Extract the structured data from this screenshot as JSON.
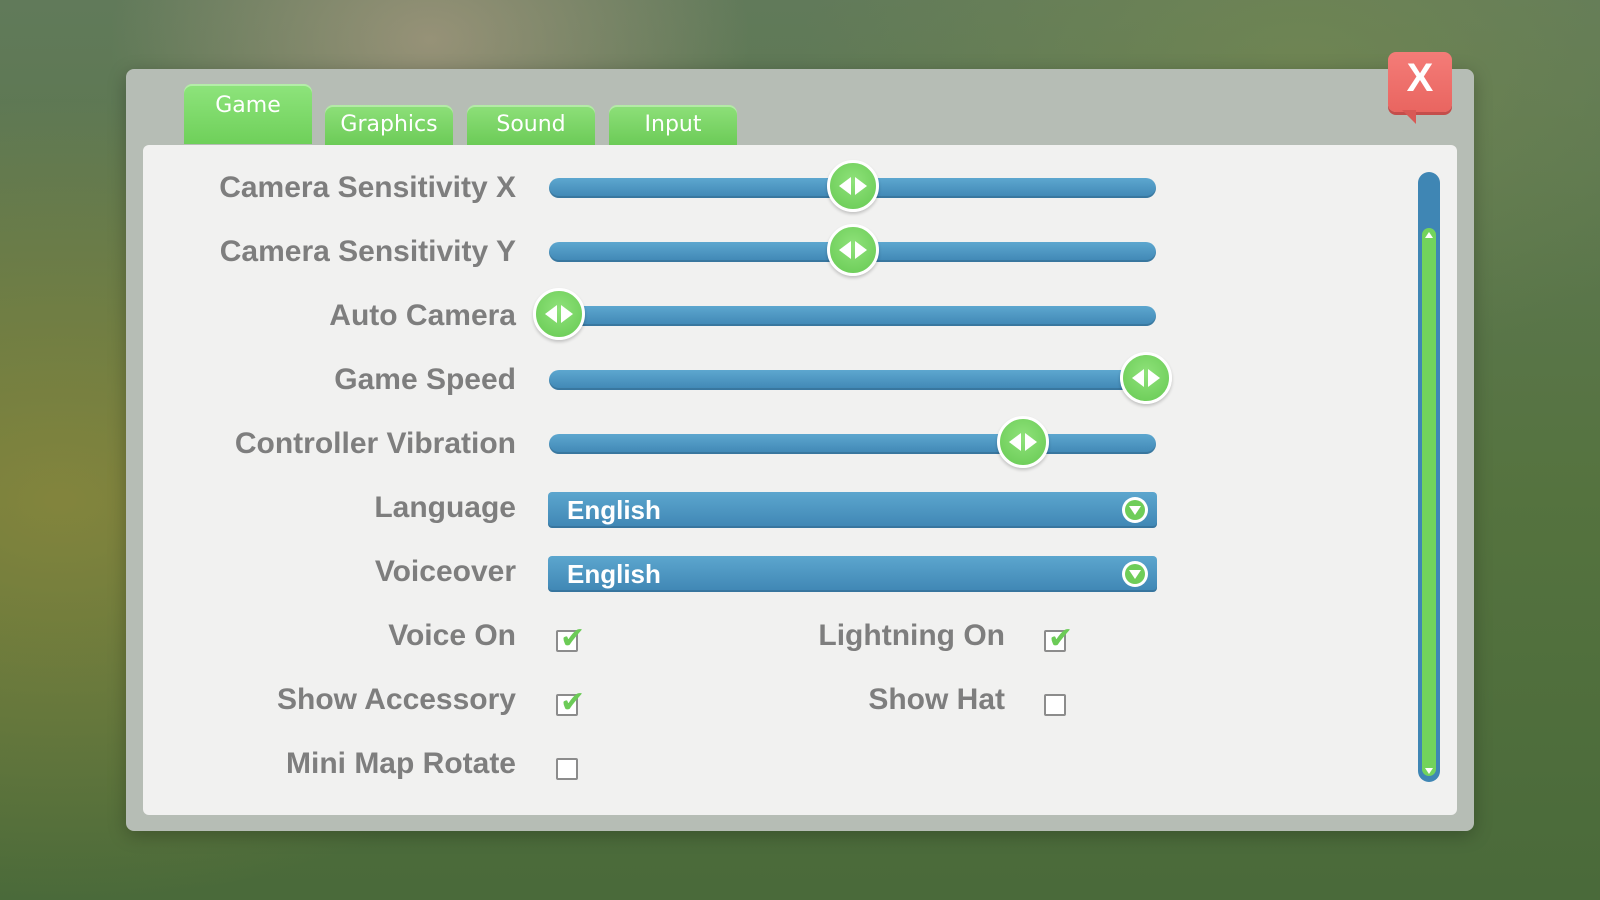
{
  "tabs": [
    {
      "label": "Game",
      "active": true
    },
    {
      "label": "Graphics",
      "active": false
    },
    {
      "label": "Sound",
      "active": false
    },
    {
      "label": "Input",
      "active": false
    }
  ],
  "close": {
    "label": "X"
  },
  "sliders": [
    {
      "label": "Camera Sensitivity X",
      "value": 0.5
    },
    {
      "label": "Camera Sensitivity Y",
      "value": 0.5
    },
    {
      "label": "Auto Camera",
      "value": 0.0
    },
    {
      "label": "Game Speed",
      "value": 1.0
    },
    {
      "label": "Controller Vibration",
      "value": 0.79
    }
  ],
  "dropdowns": [
    {
      "label": "Language",
      "value": "English"
    },
    {
      "label": "Voiceover",
      "value": "English"
    }
  ],
  "checkboxes": {
    "voice_on": {
      "label": "Voice On",
      "checked": true
    },
    "lightning_on": {
      "label": "Lightning On",
      "checked": true
    },
    "show_accessory": {
      "label": "Show Accessory",
      "checked": true
    },
    "show_hat": {
      "label": "Show Hat",
      "checked": false
    },
    "mini_map_rotate": {
      "label": "Mini Map Rotate",
      "checked": false
    }
  },
  "colors": {
    "accent_green": "#6ccb57",
    "track_blue": "#3f86b4",
    "close_red": "#e96560",
    "panel_bg": "#f1f1f0"
  },
  "icons": {
    "close": "close-icon",
    "slider_knob": "left-right-arrows-icon",
    "dropdown": "chevron-down-icon",
    "checkmark": "checkmark-icon"
  }
}
